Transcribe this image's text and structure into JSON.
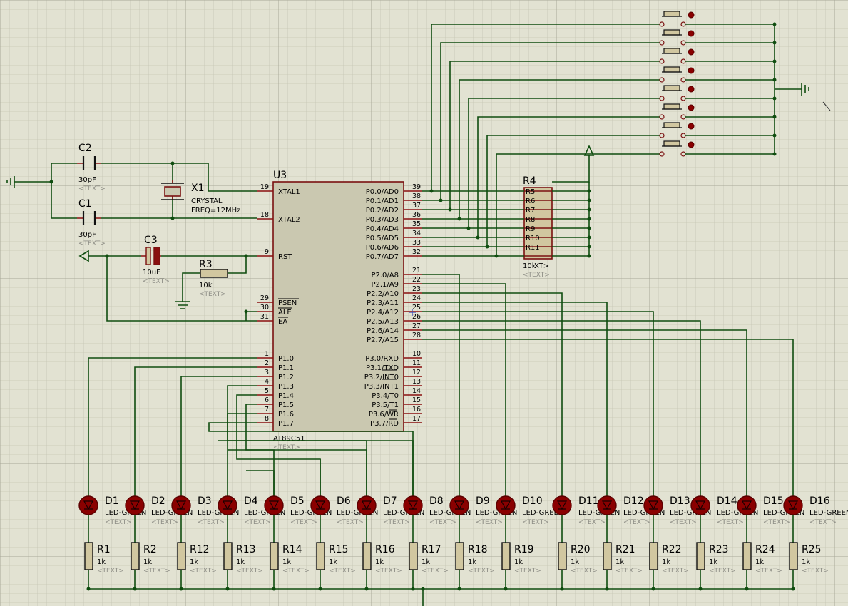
{
  "colors": {
    "grid_bg": "#e2e2d2",
    "wire": "#0f4d0f",
    "component_border": "#7a1010",
    "ic_fill": "#cac8b0",
    "led_fill": "#8a0000"
  },
  "mcu": {
    "ref": "U3",
    "part": "AT89C51",
    "placeholder": "<TEXT>",
    "left_pins": [
      {
        "num": "19",
        "name": "XTAL1"
      },
      {
        "num": "18",
        "name": "XTAL2"
      },
      {
        "num": "9",
        "name": "RST"
      },
      {
        "num": "29",
        "name": "PSEN"
      },
      {
        "num": "30",
        "name": "ALE"
      },
      {
        "num": "31",
        "name": "EA"
      },
      {
        "num": "1",
        "name": "P1.0"
      },
      {
        "num": "2",
        "name": "P1.1"
      },
      {
        "num": "3",
        "name": "P1.2"
      },
      {
        "num": "4",
        "name": "P1.3"
      },
      {
        "num": "5",
        "name": "P1.4"
      },
      {
        "num": "6",
        "name": "P1.5"
      },
      {
        "num": "7",
        "name": "P1.6"
      },
      {
        "num": "8",
        "name": "P1.7"
      }
    ],
    "right_pins": [
      {
        "num": "39",
        "name": "P0.0/AD0"
      },
      {
        "num": "38",
        "name": "P0.1/AD1"
      },
      {
        "num": "37",
        "name": "P0.2/AD2"
      },
      {
        "num": "36",
        "name": "P0.3/AD3"
      },
      {
        "num": "35",
        "name": "P0.4/AD4"
      },
      {
        "num": "34",
        "name": "P0.5/AD5"
      },
      {
        "num": "33",
        "name": "P0.6/AD6"
      },
      {
        "num": "32",
        "name": "P0.7/AD7"
      },
      {
        "num": "21",
        "name": "P2.0/A8"
      },
      {
        "num": "22",
        "name": "P2.1/A9"
      },
      {
        "num": "23",
        "name": "P2.2/A10"
      },
      {
        "num": "24",
        "name": "P2.3/A11"
      },
      {
        "num": "25",
        "name": "P2.4/A12"
      },
      {
        "num": "26",
        "name": "P2.5/A13"
      },
      {
        "num": "27",
        "name": "P2.6/A14"
      },
      {
        "num": "28",
        "name": "P2.7/A15"
      },
      {
        "num": "10",
        "name": "P3.0/RXD"
      },
      {
        "num": "11",
        "name": "P3.1/TXD"
      },
      {
        "num": "12",
        "name": "P3.2/INT0"
      },
      {
        "num": "13",
        "name": "P3.3/INT1"
      },
      {
        "num": "14",
        "name": "P3.4/T0"
      },
      {
        "num": "15",
        "name": "P3.5/T1"
      },
      {
        "num": "16",
        "name": "P3.6/WR"
      },
      {
        "num": "17",
        "name": "P3.7/RD"
      }
    ]
  },
  "crystal": {
    "ref": "X1",
    "part": "CRYSTAL",
    "freq": "FREQ=12MHz"
  },
  "capacitors": [
    {
      "ref": "C2",
      "value": "30pF",
      "placeholder": "<TEXT>"
    },
    {
      "ref": "C1",
      "value": "30pF",
      "placeholder": "<TEXT>"
    },
    {
      "ref": "C3",
      "value": "10uF",
      "placeholder": "<TEXT>"
    }
  ],
  "reset_resistor": {
    "ref": "R3",
    "value": "10k",
    "placeholder": "<TEXT>"
  },
  "resistor_pack": {
    "ref": "R4",
    "value": "10k",
    "value_overlap": "XT>",
    "placeholder": "<TEXT>",
    "overlapped_labels": [
      "R5",
      "R6",
      "R7",
      "R8",
      "R9",
      "R10",
      "R11"
    ]
  },
  "leds": [
    {
      "ref": "D1",
      "part": "LED-GREEN",
      "placeholder": "<TEXT>"
    },
    {
      "ref": "D2",
      "part": "LED-GREEN",
      "placeholder": "<TEXT>"
    },
    {
      "ref": "D3",
      "part": "LED-GREEN",
      "placeholder": "<TEXT>"
    },
    {
      "ref": "D4",
      "part": "LED-GREEN",
      "placeholder": "<TEXT>"
    },
    {
      "ref": "D5",
      "part": "LED-GREEN",
      "placeholder": "<TEXT>"
    },
    {
      "ref": "D6",
      "part": "LED-GREEN",
      "placeholder": "<TEXT>"
    },
    {
      "ref": "D7",
      "part": "LED-GREEN",
      "placeholder": "<TEXT>"
    },
    {
      "ref": "D8",
      "part": "LED-GREEN",
      "placeholder": "<TEXT>"
    },
    {
      "ref": "D9",
      "part": "LED-GREEN",
      "placeholder": "<TEXT>"
    },
    {
      "ref": "D10",
      "part": "LED-GREEN",
      "placeholder": "<TEXT>"
    },
    {
      "ref": "D11",
      "part": "LED-GREEN",
      "placeholder": "<TEXT>"
    },
    {
      "ref": "D12",
      "part": "LED-GREEN",
      "placeholder": "<TEXT>"
    },
    {
      "ref": "D13",
      "part": "LED-GREEN",
      "placeholder": "<TEXT>"
    },
    {
      "ref": "D14",
      "part": "LED-GREEN",
      "placeholder": "<TEXT>"
    },
    {
      "ref": "D15",
      "part": "LED-GREEN",
      "placeholder": "<TEXT>"
    },
    {
      "ref": "D16",
      "part": "LED-GREEN",
      "placeholder": "<TEXT>"
    }
  ],
  "led_resistors": [
    {
      "ref": "R1",
      "value": "1k",
      "placeholder": "<TEXT>"
    },
    {
      "ref": "R2",
      "value": "1k",
      "placeholder": "<TEXT>"
    },
    {
      "ref": "R12",
      "value": "1k",
      "placeholder": "<TEXT>"
    },
    {
      "ref": "R13",
      "value": "1k",
      "placeholder": "<TEXT>"
    },
    {
      "ref": "R14",
      "value": "1k",
      "placeholder": "<TEXT>"
    },
    {
      "ref": "R15",
      "value": "1k",
      "placeholder": "<TEXT>"
    },
    {
      "ref": "R16",
      "value": "1k",
      "placeholder": "<TEXT>"
    },
    {
      "ref": "R17",
      "value": "1k",
      "placeholder": "<TEXT>"
    },
    {
      "ref": "R18",
      "value": "1k",
      "placeholder": "<TEXT>"
    },
    {
      "ref": "R19",
      "value": "1k",
      "placeholder": "<TEXT>"
    },
    {
      "ref": "R20",
      "value": "1k",
      "placeholder": "<TEXT>"
    },
    {
      "ref": "R21",
      "value": "1k",
      "placeholder": "<TEXT>"
    },
    {
      "ref": "R22",
      "value": "1k",
      "placeholder": "<TEXT>"
    },
    {
      "ref": "R23",
      "value": "1k",
      "placeholder": "<TEXT>"
    },
    {
      "ref": "R24",
      "value": "1k",
      "placeholder": "<TEXT>"
    },
    {
      "ref": "R25",
      "value": "1k",
      "placeholder": "<TEXT>"
    }
  ],
  "buttons": {
    "count": 8
  }
}
